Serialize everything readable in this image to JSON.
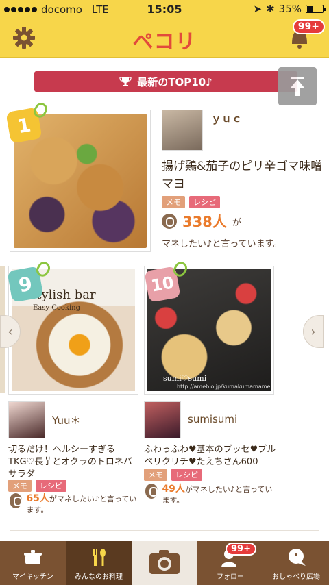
{
  "status": {
    "carrier": "docomo",
    "network": "LTE",
    "time": "15:05",
    "battery": "35%",
    "battery_level": 0.35
  },
  "header": {
    "logo": "ペコリ",
    "badge": "99+"
  },
  "banner": {
    "title": "最新のTOP10♪"
  },
  "featured": {
    "rank": "1",
    "user": "ｙｕｃ",
    "title": "揚げ鶏&茄子のピリ辛ゴマ味噌マヨ",
    "tag_memo": "メモ",
    "tag_recipe": "レシピ",
    "count": "338人",
    "count_suffix": "が",
    "say": "マネしたい♪と言っています。"
  },
  "cards": [
    {
      "rank": "9",
      "image_text": "stylish bar",
      "image_subtext": "Easy Cooking",
      "user": "Yuu＊",
      "title": "切るだけ！ヘルシーすぎるTKG♡長芋とオクラのトロネバサラダ",
      "tag_memo": "メモ",
      "tag_recipe": "レシピ",
      "count": "65人",
      "say": "がマネしたい♪と言っています。"
    },
    {
      "rank": "10",
      "image_text": "sumi♡sumi",
      "image_subtext": "http://ameblo.jp/kumakumamame",
      "user": "sumisumi",
      "title": "ふわっふわ♥基本のブッセ♥ブルベリクリチ♥たえちさん600",
      "tag_memo": "メモ",
      "tag_recipe": "レシピ",
      "count": "49人",
      "say": "がマネしたい♪と言っています。"
    }
  ],
  "tabs": [
    {
      "label": "マイキッチン",
      "icon": "pot-icon"
    },
    {
      "label": "みんなのお料理",
      "icon": "fork-spoon-icon"
    },
    {
      "label": "",
      "icon": "camera-icon"
    },
    {
      "label": "フォロー",
      "icon": "follow-icon",
      "badge": "99+"
    },
    {
      "label": "おしゃべり広場",
      "icon": "chat-icon"
    }
  ],
  "colors": {
    "header": "#f7d64a",
    "banner": "#c73a4e",
    "accent_orange": "#ea7b2c",
    "tabbar": "#7a5232"
  }
}
